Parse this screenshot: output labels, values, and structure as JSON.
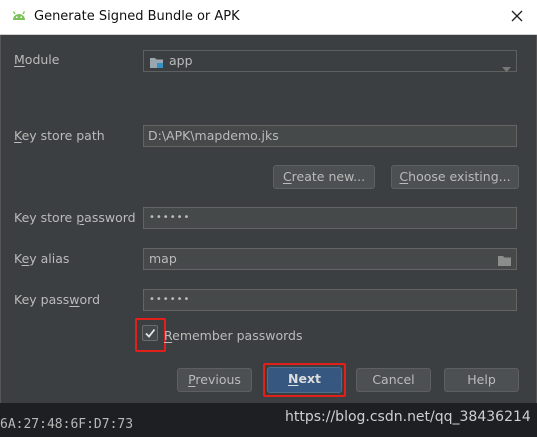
{
  "window": {
    "title": "Generate Signed Bundle or APK"
  },
  "form": {
    "module": {
      "label_u": "M",
      "label_rest": "odule",
      "value": "app"
    },
    "key_store_path": {
      "label_u": "K",
      "label_rest": "ey store path",
      "value": "D:\\APK\\mapdemo.jks"
    },
    "create_new": {
      "label_u": "C",
      "label_rest": "reate new..."
    },
    "choose_existing": {
      "label_u": "C",
      "label_rest": "hoose existing..."
    },
    "key_store_password": {
      "label_pre": "Key store ",
      "label_u": "p",
      "label_rest": "assword",
      "value": "••••••"
    },
    "key_alias": {
      "label_pre": "K",
      "label_u": "e",
      "label_rest": "y alias",
      "value": "map"
    },
    "key_password": {
      "label_pre": "Key pass",
      "label_u": "w",
      "label_rest": "ord",
      "value": "••••••"
    },
    "remember": {
      "label_u": "R",
      "label_rest": "emember passwords",
      "checked": true
    }
  },
  "buttons": {
    "previous": {
      "u": "P",
      "rest": "revious"
    },
    "next": {
      "u": "N",
      "rest": "ext"
    },
    "cancel": "Cancel",
    "help": "Help"
  },
  "background": {
    "fingerprint": "6A:27:48:6F:D7:73",
    "watermark": "https://blog.csdn.net/qq_38436214"
  },
  "colors": {
    "dialog_bg": "#3c3f41",
    "primary_button": "#365880",
    "highlight": "#e0211b",
    "android": "#78c257"
  }
}
